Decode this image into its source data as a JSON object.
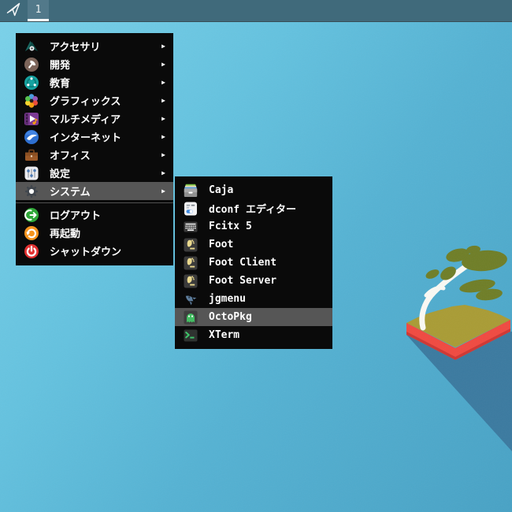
{
  "topbar": {
    "launcher_icon": "paper-plane-icon",
    "workspace": {
      "label": "1",
      "active": true
    }
  },
  "menu": {
    "submenu_arrow": "▶",
    "categories": [
      {
        "label": "アクセサリ",
        "icon": "accessories-icon"
      },
      {
        "label": "開発",
        "icon": "development-icon"
      },
      {
        "label": "教育",
        "icon": "education-icon"
      },
      {
        "label": "グラフィックス",
        "icon": "graphics-icon"
      },
      {
        "label": "マルチメディア",
        "icon": "multimedia-icon"
      },
      {
        "label": "インターネット",
        "icon": "internet-icon"
      },
      {
        "label": "オフィス",
        "icon": "office-icon"
      },
      {
        "label": "設定",
        "icon": "settings-icon"
      },
      {
        "label": "システム",
        "icon": "system-icon",
        "highlighted": true
      }
    ],
    "actions": [
      {
        "label": "ログアウト",
        "icon": "logout-icon"
      },
      {
        "label": "再起動",
        "icon": "restart-icon"
      },
      {
        "label": "シャットダウン",
        "icon": "shutdown-icon"
      }
    ]
  },
  "submenu": {
    "items": [
      {
        "label": "Caja",
        "icon": "caja-icon"
      },
      {
        "label": "dconf エディター",
        "icon": "dconf-editor-icon"
      },
      {
        "label": "Fcitx 5",
        "icon": "fcitx-keyboard-icon"
      },
      {
        "label": "Foot",
        "icon": "foot-terminal-icon"
      },
      {
        "label": "Foot Client",
        "icon": "foot-terminal-icon"
      },
      {
        "label": "Foot Server",
        "icon": "foot-terminal-icon"
      },
      {
        "label": "jgmenu",
        "icon": "jgmenu-rocket-icon"
      },
      {
        "label": "OctoPkg",
        "icon": "octopkg-ghost-icon",
        "highlighted": true
      },
      {
        "label": "XTerm",
        "icon": "xterm-icon"
      }
    ]
  },
  "colors": {
    "topbar": "#406a7b",
    "workspace_tab": "#52798a",
    "workspace_underline": "#fbfbfb",
    "menu_background": "#0a0a0a",
    "menu_highlight": "#565656",
    "menu_text": "#ffffff",
    "desktop_top": "#7bd2ea",
    "desktop_bottom": "#48a2c5",
    "island_surface": "#a99c35",
    "island_side_red": "#f04a41",
    "tree_leaves": "#6f7e27",
    "tree_trunk": "#faf9f4",
    "cast_shadow": "#3b7aa0"
  }
}
